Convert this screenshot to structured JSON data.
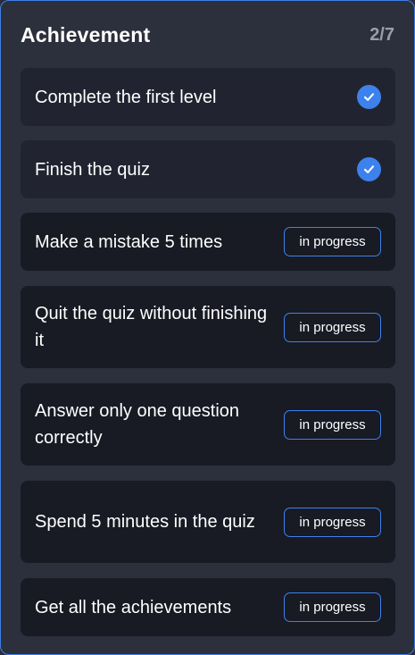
{
  "header": {
    "title": "Achievement",
    "counter": "2/7"
  },
  "achievements": [
    {
      "label": "Complete the first level",
      "status": "completed"
    },
    {
      "label": "Finish the quiz",
      "status": "completed"
    },
    {
      "label": "Make a mistake 5 times",
      "status": "in progress"
    },
    {
      "label": "Quit the quiz without finishing it",
      "status": "in progress"
    },
    {
      "label": "Answer only one question correctly",
      "status": "in progress"
    },
    {
      "label": "Spend 5 minutes in the quiz",
      "status": "in progress"
    },
    {
      "label": "Get all the achievements",
      "status": "in progress"
    }
  ],
  "colors": {
    "accent": "#3d82ec",
    "panel_background": "#2c2f3c",
    "card_background": "#181a24"
  },
  "icons": {
    "completed": "check-circle-icon"
  }
}
